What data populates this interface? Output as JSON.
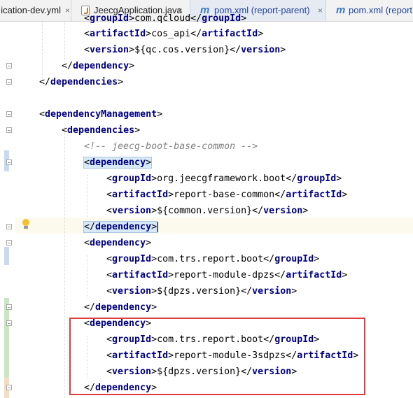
{
  "tabs": [
    {
      "label": "ication-dev.yml",
      "has_close": true
    },
    {
      "label": "JeecgApplication.java",
      "has_close": true
    },
    {
      "label": "pom.xml (report-parent)",
      "has_close": true
    },
    {
      "label": "pom.xml (report",
      "has_close": false
    }
  ],
  "icons": {
    "tab_close": "×",
    "maven": "m"
  },
  "code": {
    "l01": {
      "b": "<",
      "t": "groupId",
      "c": ">com.qcloud</",
      "t2": "groupId",
      "e": ">"
    },
    "l02": {
      "b": "<",
      "t": "artifactId",
      "c": ">cos_api</",
      "t2": "artifactId",
      "e": ">"
    },
    "l03": {
      "b": "<",
      "t": "version",
      "c": ">${qc.cos.version}</",
      "t2": "version",
      "e": ">"
    },
    "l04": {
      "b": "</",
      "t": "dependency",
      "e": ">"
    },
    "l05": {
      "b": "</",
      "t": "dependencies",
      "e": ">"
    },
    "l07": {
      "b": "<",
      "t": "dependencyManagement",
      "e": ">"
    },
    "l08": {
      "b": "<",
      "t": "dependencies",
      "e": ">"
    },
    "l09": {
      "comment": "<!-- jeecg-boot-base-common -->"
    },
    "l10": {
      "b": "<",
      "t": "dependency",
      "e": ">"
    },
    "l11": {
      "b": "<",
      "t": "groupId",
      "c": ">org.jeecgframework.boot</",
      "t2": "groupId",
      "e": ">"
    },
    "l12": {
      "b": "<",
      "t": "artifactId",
      "c": ">report-base-common</",
      "t2": "artifactId",
      "e": ">"
    },
    "l13": {
      "b": "<",
      "t": "version",
      "c": ">${common.version}</",
      "t2": "version",
      "e": ">"
    },
    "l14": {
      "b": "</",
      "t": "dependency",
      "e": ">"
    },
    "l15": {
      "b": "<",
      "t": "dependency",
      "e": ">"
    },
    "l16": {
      "b": "<",
      "t": "groupId",
      "c": ">com.trs.report.boot</",
      "t2": "groupId",
      "e": ">"
    },
    "l17": {
      "b": "<",
      "t": "artifactId",
      "c": ">report-module-dpzs</",
      "t2": "artifactId",
      "e": ">"
    },
    "l18": {
      "b": "<",
      "t": "version",
      "c": ">${dpzs.version}</",
      "t2": "version",
      "e": ">"
    },
    "l19": {
      "b": "</",
      "t": "dependency",
      "e": ">"
    },
    "l20": {
      "b": "<",
      "t": "dependency",
      "e": ">"
    },
    "l21": {
      "b": "<",
      "t": "groupId",
      "c": ">com.trs.report.boot</",
      "t2": "groupId",
      "e": ">"
    },
    "l22": {
      "b": "<",
      "t": "artifactId",
      "c": ">report-module-3sdpzs</",
      "t2": "artifactId",
      "e": ">"
    },
    "l23": {
      "b": "<",
      "t": "version",
      "c": ">${dpzs.version}</",
      "t2": "version",
      "e": ">"
    },
    "l24": {
      "b": "</",
      "t": "dependency",
      "e": ">"
    }
  },
  "colors": {
    "tag": "#000080",
    "text": "#000000",
    "comment": "#808080",
    "tag_match_highlight": "#d7e9f7",
    "caret_row": "#fcfaed",
    "annotation": "#e23b3b"
  }
}
